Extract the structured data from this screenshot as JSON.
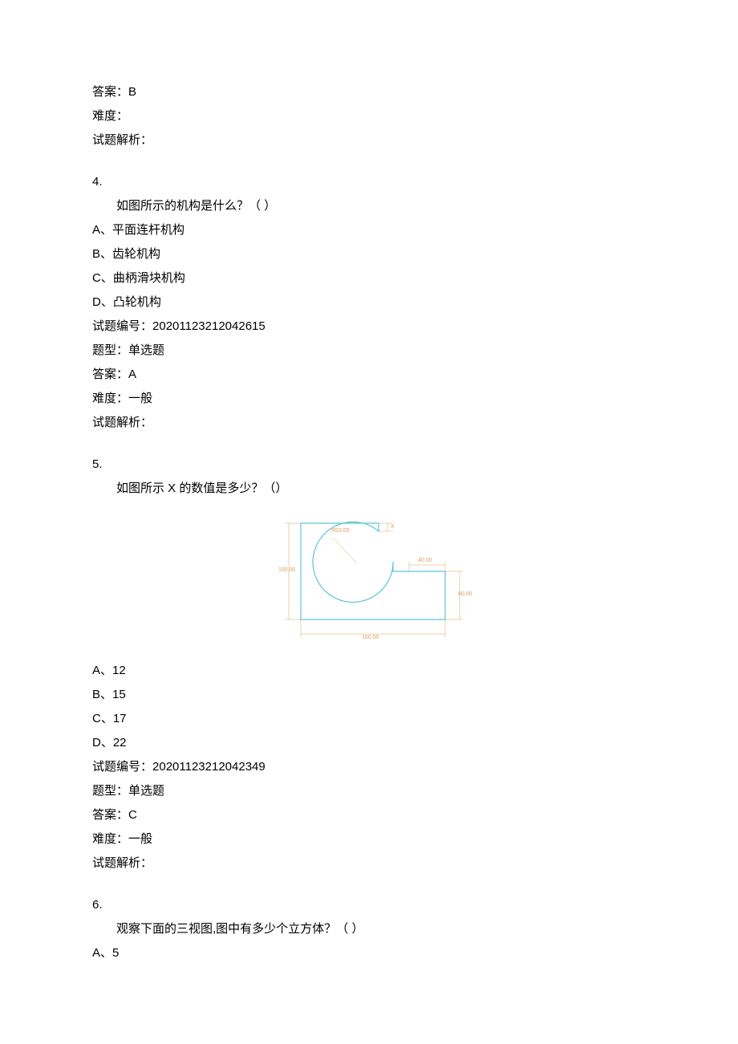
{
  "q3": {
    "answer_label": "答案：",
    "answer": "B",
    "difficulty_label": "难度：",
    "difficulty": "",
    "analysis_label": "试题解析：",
    "analysis": ""
  },
  "q4": {
    "number": "4.",
    "prompt": "如图所示的机构是什么？（          ）",
    "options": {
      "a": "A、平面连杆机构",
      "b": "B、齿轮机构",
      "c": "C、曲柄滑块机构",
      "d": "D、凸轮机构"
    },
    "id_label": "试题编号：",
    "id": "20201123212042615",
    "type_label": "题型：",
    "type": "单选题",
    "answer_label": "答案：",
    "answer": "A",
    "difficulty_label": "难度：",
    "difficulty": "一般",
    "analysis_label": "试题解析：",
    "analysis": ""
  },
  "q5": {
    "number": "5.",
    "prompt": "如图所示 X 的数值是多少？（）",
    "options": {
      "a": "A、12",
      "b": "B、15",
      "c": "C、17",
      "d": "D、22"
    },
    "id_label": "试题编号：",
    "id": "20201123212042349",
    "type_label": "题型：",
    "type": "单选题",
    "answer_label": "答案：",
    "answer": "C",
    "difficulty_label": "难度：",
    "difficulty": "一般",
    "analysis_label": "试题解析：",
    "analysis": ""
  },
  "q6": {
    "number": "6.",
    "prompt": "观察下面的三视图,图中有多少个立方体？（           ）",
    "options": {
      "a": "A、5"
    }
  },
  "figure": {
    "radius_label": "R53.00",
    "width_label": "160.00",
    "right_w_label": "40.00",
    "right_h_label": "60.00",
    "left_h_label": "100.00",
    "top_notch_label": "X"
  }
}
